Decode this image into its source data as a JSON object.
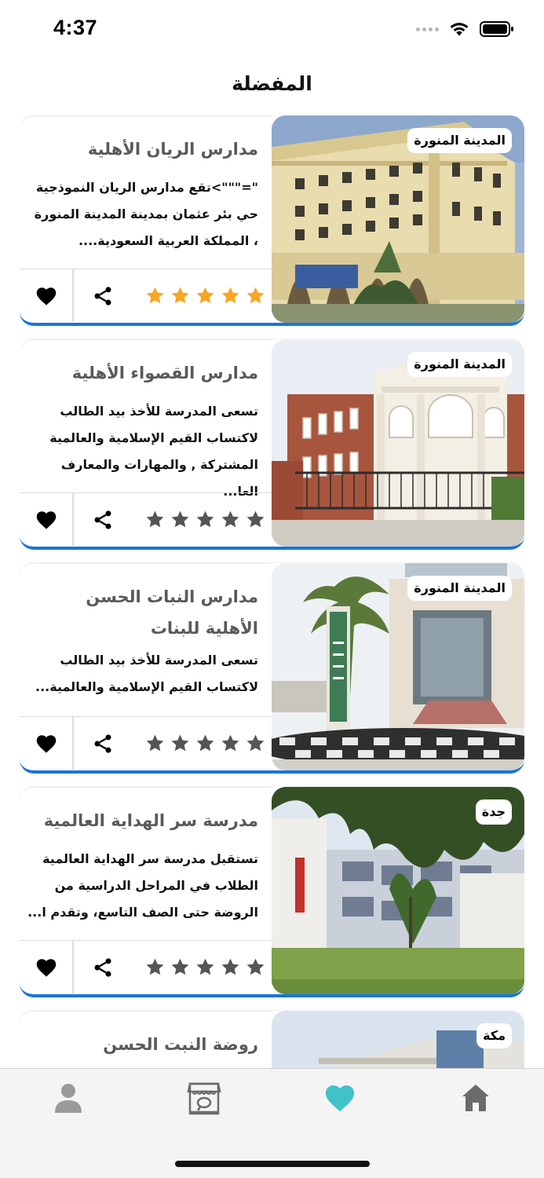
{
  "status_bar": {
    "time": "4:37",
    "icons": [
      "signal-dots-icon",
      "wifi-icon",
      "battery-icon"
    ]
  },
  "header": {
    "title": "المفضلة"
  },
  "colors": {
    "accent_blue": "#1a75d9",
    "star_filled": "#f6a623",
    "star_empty": "#555555",
    "tab_active": "#3fc3c8",
    "tab_inactive": "#9a9a9a"
  },
  "schools": [
    {
      "name": "مدارس الريان الأهلية",
      "city": "المدينة المنورة",
      "description": "\"=\"\"\">تقع مدارس الريان النموذجية حي بئر عثمان بمدينة المدينة المنورة ، المملكة العربية السعودية....",
      "rating": 5,
      "image": "white-arched-school-building"
    },
    {
      "name": "مدارس القصواء الأهلية",
      "city": "المدينة المنورة",
      "description": "تسعى المدرسة للأخذ بيد الطالب لاكتساب القيم الإسلامية والعالمية المشتركة , والمهارات والمعارف العا...",
      "rating": 0,
      "image": "red-brick-school-with-gate"
    },
    {
      "name": "مدارس النبات الحسن الأهلية للبنات",
      "city": "المدينة المنورة",
      "description": "تسعى المدرسة للأخذ بيد الطالب لاكتساب القيم الإسلامية والعالمية...",
      "rating": 0,
      "image": "school-entrance-with-palm"
    },
    {
      "name": "مدرسة سر الهداية العالمية",
      "city": "جدة",
      "description": "تستقبل مدرسة سر الهداية العالمية الطلاب في المراحل الدراسية من الروضة حتى الصف التاسع، وتقدم ا...",
      "rating": 0,
      "image": "modern-school-with-trees"
    },
    {
      "name": "روضة النبت الحسن",
      "city": "مكة",
      "description": "",
      "rating": 0,
      "image": "kindergarten-building"
    }
  ],
  "tab_bar": {
    "tabs": [
      {
        "icon": "profile-icon",
        "active": false
      },
      {
        "icon": "store-icon",
        "active": false
      },
      {
        "icon": "heart-icon",
        "active": true
      },
      {
        "icon": "home-icon",
        "active": false
      }
    ]
  }
}
